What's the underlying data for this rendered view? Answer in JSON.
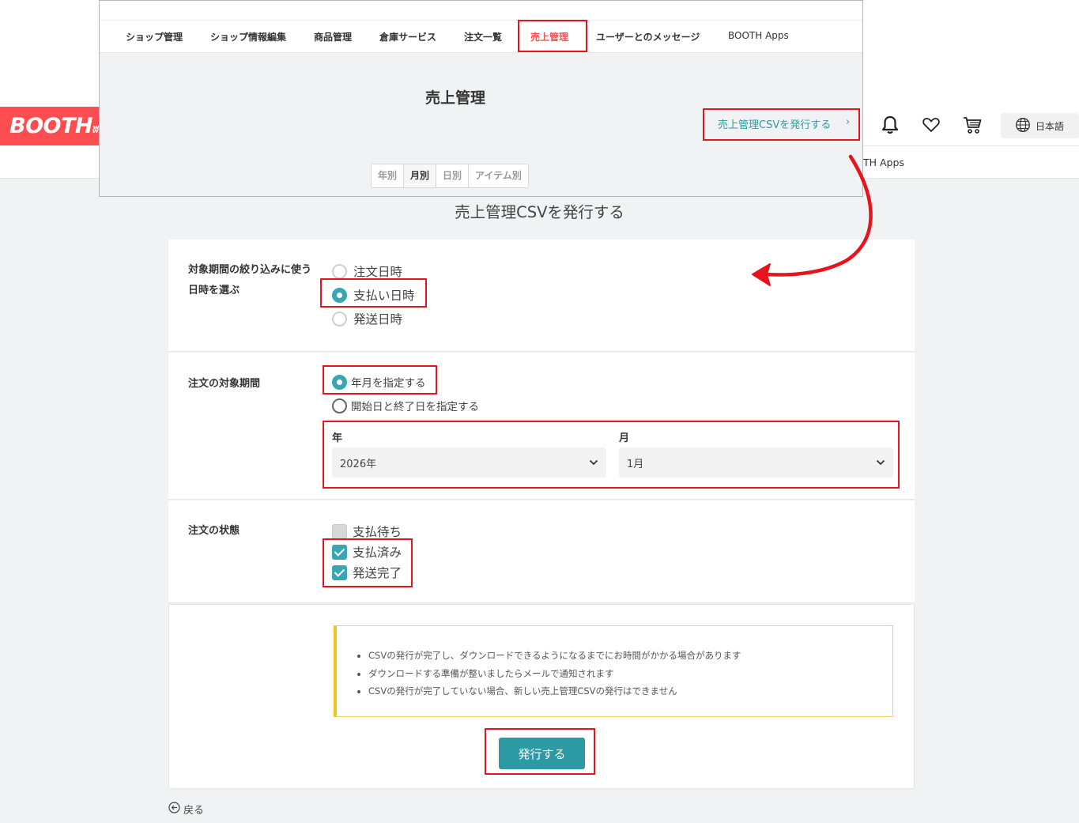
{
  "site": {
    "logo_text": "BOOTH",
    "nav_partial": "TH Apps",
    "lang_label": "日本語",
    "icons": [
      "bell-icon",
      "heart-icon",
      "cart-icon",
      "globe-icon"
    ]
  },
  "overlay": {
    "nav": [
      "ショップ管理",
      "ショップ情報編集",
      "商品管理",
      "倉庫サービス",
      "注文一覧",
      "売上管理",
      "ユーザーとのメッセージ",
      "BOOTH Apps"
    ],
    "active_nav": "売上管理",
    "title": "売上管理",
    "csv_link": "売上管理CSVを発行する",
    "tabs": [
      "年別",
      "月別",
      "日別",
      "アイテム別"
    ],
    "active_tab": "月別"
  },
  "page": {
    "title": "売上管理CSVを発行する",
    "period_filter": {
      "label": "対象期間の絞り込みに使う日時を選ぶ",
      "options": [
        "注文日時",
        "支払い日時",
        "発送日時"
      ],
      "selected": "支払い日時"
    },
    "order_period": {
      "label": "注文の対象期間",
      "options": [
        "年月を指定する",
        "開始日と終了日を指定する"
      ],
      "selected": "年月を指定する",
      "year_label": "年",
      "year_value": "2026年",
      "month_label": "月",
      "month_value": "1月"
    },
    "order_status": {
      "label": "注文の状態",
      "options": [
        "支払待ち",
        "支払済み",
        "発送完了"
      ],
      "checked": [
        "支払済み",
        "発送完了"
      ]
    },
    "notice": [
      "CSVの発行が完了し、ダウンロードできるようになるまでにお時間がかかる場合があります",
      "ダウンロードする準備が整いましたらメールで通知されます",
      "CSVの発行が完了していない場合、新しい売上管理CSVの発行はできません"
    ],
    "submit_label": "発行する",
    "back_label": "戻る"
  },
  "colors": {
    "brand": "#fc4d50",
    "accent": "#3aa7b0",
    "button": "#2d9aa3",
    "annotation": "#e8141d",
    "notice_border": "#f5c31f"
  }
}
